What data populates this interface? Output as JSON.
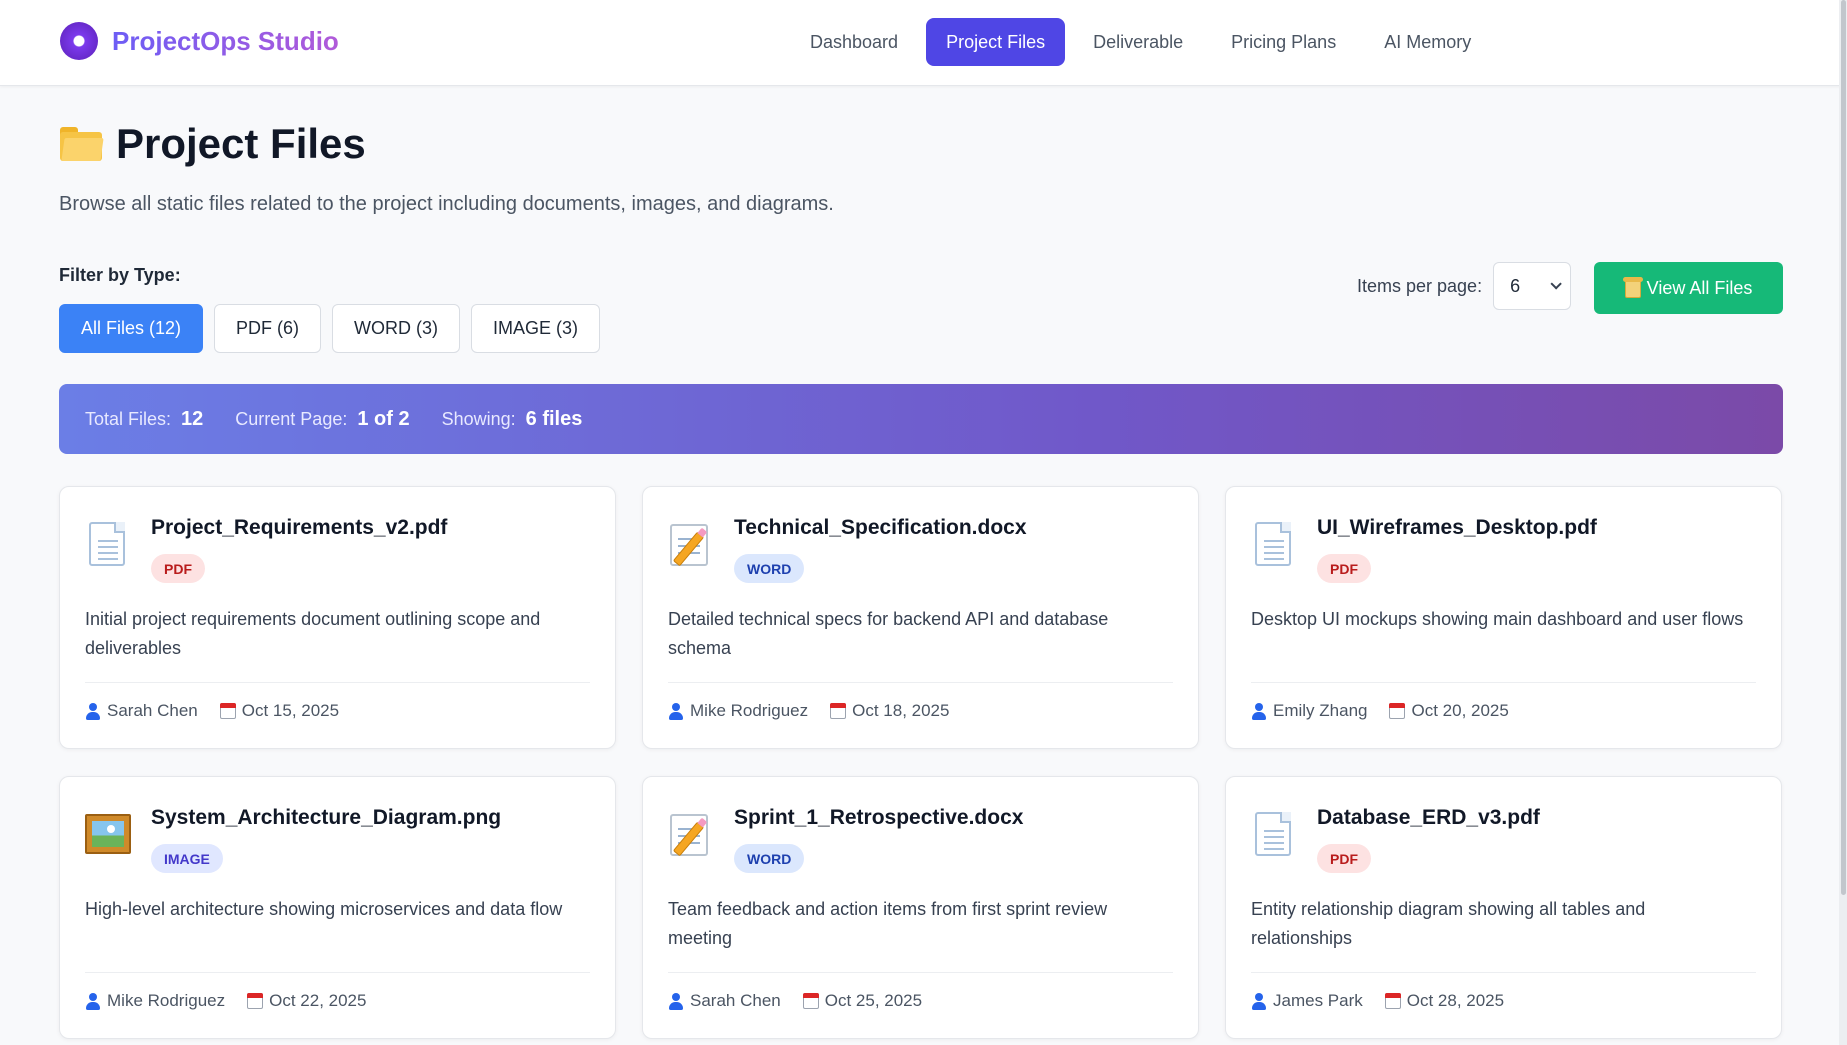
{
  "header": {
    "brand": "ProjectOps Studio",
    "nav": [
      {
        "label": "Dashboard",
        "active": false
      },
      {
        "label": "Project Files",
        "active": true
      },
      {
        "label": "Deliverable",
        "active": false
      },
      {
        "label": "Pricing Plans",
        "active": false
      },
      {
        "label": "AI Memory",
        "active": false
      }
    ]
  },
  "page": {
    "title": "Project Files",
    "subtitle": "Browse all static files related to the project including documents, images, and diagrams."
  },
  "filters": {
    "label": "Filter by Type:",
    "options": [
      {
        "label": "All Files (12)",
        "active": true
      },
      {
        "label": "PDF (6)",
        "active": false
      },
      {
        "label": "WORD (3)",
        "active": false
      },
      {
        "label": "IMAGE (3)",
        "active": false
      }
    ]
  },
  "pagination": {
    "items_per_page_label": "Items per page:",
    "items_per_page_value": "6",
    "view_all_label": "View All Files"
  },
  "stats": {
    "total_label": "Total Files:",
    "total_value": "12",
    "page_label": "Current Page:",
    "page_value": "1 of 2",
    "showing_label": "Showing:",
    "showing_value": "6 files"
  },
  "files": [
    {
      "name": "Project_Requirements_v2.pdf",
      "type": "PDF",
      "icon": "document-icon",
      "description": "Initial project requirements document outlining scope and deliverables",
      "author": "Sarah Chen",
      "date": "Oct 15, 2025"
    },
    {
      "name": "Technical_Specification.docx",
      "type": "WORD",
      "icon": "memo-icon",
      "description": "Detailed technical specs for backend API and database schema",
      "author": "Mike Rodriguez",
      "date": "Oct 18, 2025"
    },
    {
      "name": "UI_Wireframes_Desktop.pdf",
      "type": "PDF",
      "icon": "document-icon",
      "description": "Desktop UI mockups showing main dashboard and user flows",
      "author": "Emily Zhang",
      "date": "Oct 20, 2025"
    },
    {
      "name": "System_Architecture_Diagram.png",
      "type": "IMAGE",
      "icon": "framed-picture-icon",
      "description": "High-level architecture showing microservices and data flow",
      "author": "Mike Rodriguez",
      "date": "Oct 22, 2025"
    },
    {
      "name": "Sprint_1_Retrospective.docx",
      "type": "WORD",
      "icon": "memo-icon",
      "description": "Team feedback and action items from first sprint review meeting",
      "author": "Sarah Chen",
      "date": "Oct 25, 2025"
    },
    {
      "name": "Database_ERD_v3.pdf",
      "type": "PDF",
      "icon": "document-icon",
      "description": "Entity relationship diagram showing all tables and relationships",
      "author": "James Park",
      "date": "Oct 28, 2025"
    }
  ]
}
